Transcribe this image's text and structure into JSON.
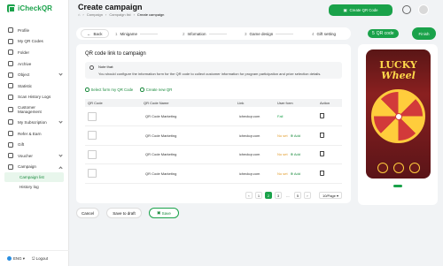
{
  "app": {
    "name": "iCheckQR"
  },
  "sidebar": {
    "items": [
      {
        "label": "Profile"
      },
      {
        "label": "My QR Codes"
      },
      {
        "label": "Folder"
      },
      {
        "label": "Archive"
      },
      {
        "label": "Object"
      },
      {
        "label": "Statistic"
      },
      {
        "label": "Scan History Logs"
      },
      {
        "label": "Customer Management"
      },
      {
        "label": "My Subscription"
      },
      {
        "label": "Refer & Earn"
      },
      {
        "label": "Gift"
      },
      {
        "label": "Voucher"
      },
      {
        "label": "Campaign"
      }
    ],
    "subitems": [
      {
        "label": "Campaign list"
      },
      {
        "label": "History log"
      }
    ],
    "lang": "ENG",
    "logout": "Logout"
  },
  "header": {
    "title": "Create campaign",
    "breadcrumb": [
      "Campaign",
      "Campaign list",
      "Create campaign"
    ],
    "create_qr": "Create QR Code"
  },
  "steps": {
    "back": "Back",
    "items": [
      {
        "num": "1",
        "label": "Minigame"
      },
      {
        "num": "2",
        "label": "Infomation"
      },
      {
        "num": "3",
        "label": "Game design"
      },
      {
        "num": "4",
        "label": "Gift setting"
      },
      {
        "num": "5",
        "label": "QR code"
      }
    ],
    "finish": "Finish"
  },
  "card": {
    "title": "QR code link to campaign",
    "note_title": "Note that:",
    "note_text": "You should configure the information form for the QR code to collect customer information for program participation and prize selection details.",
    "select_link": "Select form my QR Code",
    "create_link": "Create new QR"
  },
  "table": {
    "headers": [
      "QR Code",
      "QR Code Name",
      "Link",
      "User form",
      "Action"
    ],
    "rows": [
      {
        "name": "QR Code Marketing",
        "link": "icheckqr.com",
        "status": "Fail",
        "add": ""
      },
      {
        "name": "QR Code Marketing",
        "link": "icheckqr.com",
        "status": "No set",
        "add": "Add"
      },
      {
        "name": "QR Code Marketing",
        "link": "icheckqr.com",
        "status": "No set",
        "add": "Add"
      },
      {
        "name": "QR Code Marketing",
        "link": "icheckqr.com",
        "status": "No set",
        "add": "Add"
      }
    ]
  },
  "pagination": {
    "pages": [
      "1",
      "2",
      "3",
      "...",
      "5"
    ],
    "per_page": "10/Page"
  },
  "actions": {
    "cancel": "Cancel",
    "draft": "Save to draft",
    "save": "Save"
  },
  "preview": {
    "line1": "LUCKY",
    "line2": "Wheel"
  },
  "colors": {
    "accent": "#1aa24a"
  }
}
